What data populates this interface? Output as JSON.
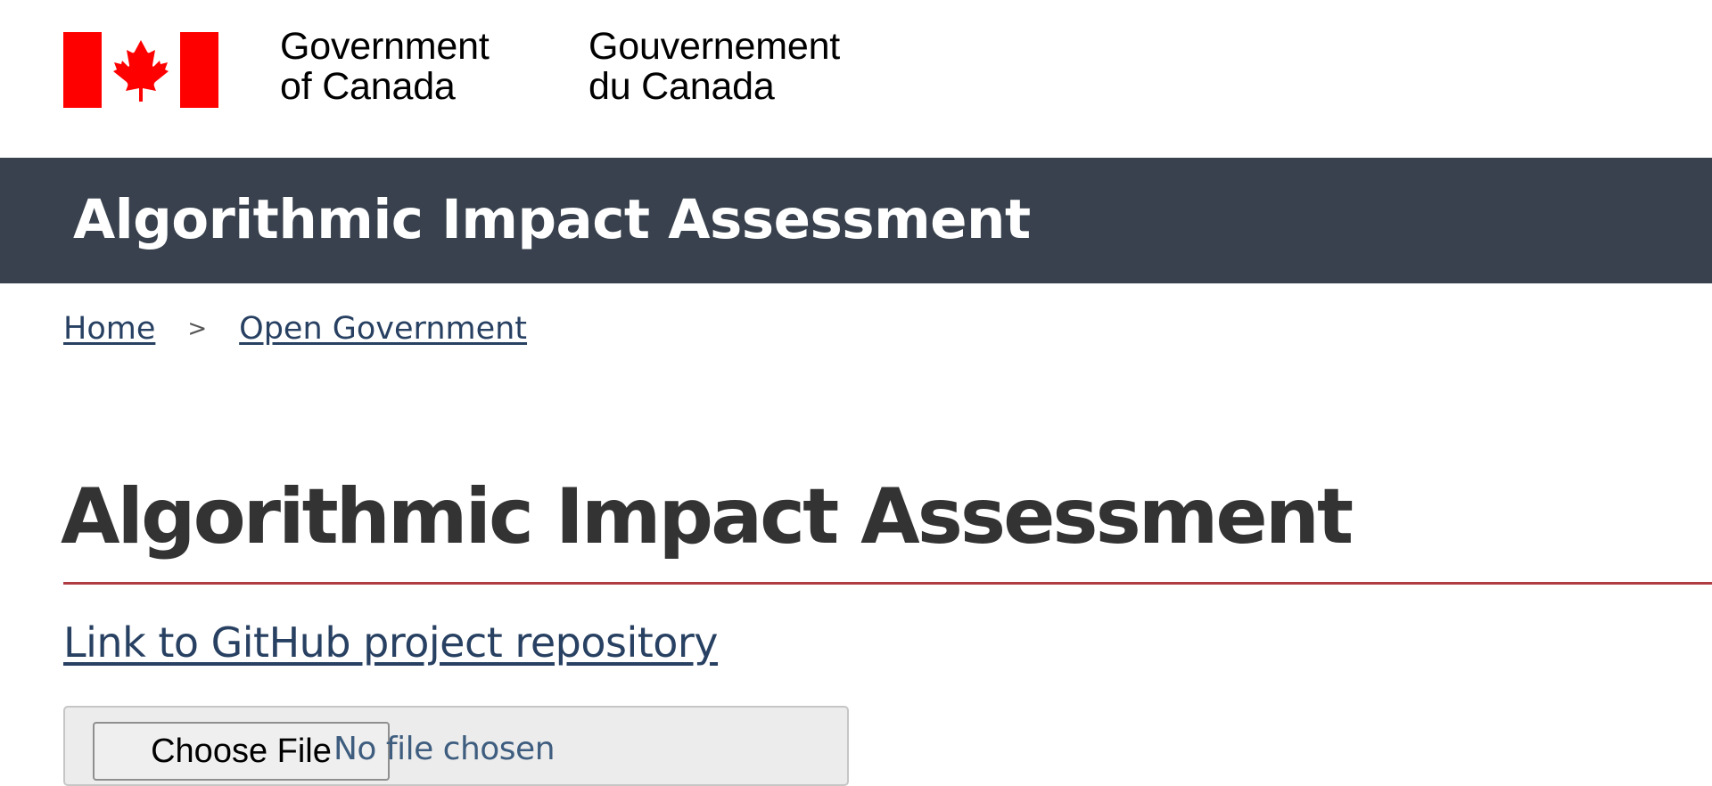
{
  "gov_header": {
    "signature_en_line1": "Government",
    "signature_en_line2": "of Canada",
    "signature_fr_line1": "Gouvernement",
    "signature_fr_line2": "du Canada",
    "flag_color": "#ff0000"
  },
  "app_banner": {
    "title": "Algorithmic Impact Assessment",
    "background_color": "#38414d"
  },
  "breadcrumb": {
    "items": [
      {
        "label": "Home"
      },
      {
        "label": "Open Government"
      }
    ],
    "separator": ">"
  },
  "main": {
    "page_title": "Algorithmic Impact Assessment",
    "title_rule_color": "#af3c43",
    "repo_link_label": "Link to GitHub project repository",
    "link_color": "#284162"
  },
  "file_input": {
    "button_label": "Choose File",
    "status_text": "No file chosen"
  },
  "icons": {
    "flag": "canada-flag-icon"
  }
}
